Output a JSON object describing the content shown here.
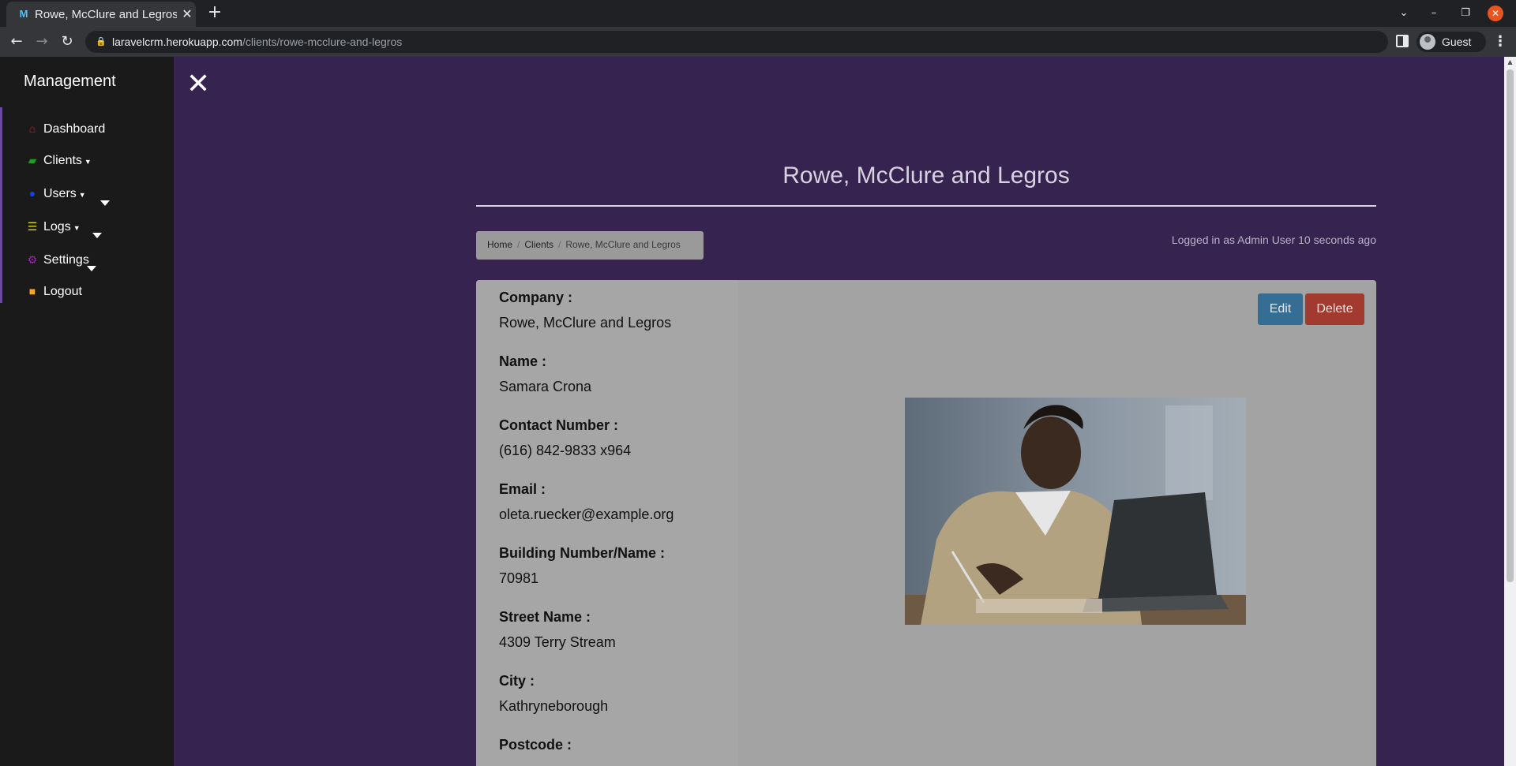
{
  "browser": {
    "tab_title": "Rowe, McClure and Legros",
    "tab_favicon": "M",
    "url_host": "laravelcrm.herokuapp.com",
    "url_path": "/clients/rowe-mcclure-and-legros",
    "profile_label": "Guest"
  },
  "sidebar": {
    "brand": "Management",
    "items": [
      {
        "label": "Dashboard",
        "icon": "home-icon",
        "color": "#d11a1a"
      },
      {
        "label": "Clients",
        "icon": "briefcase-icon",
        "color": "#1e9a1e"
      },
      {
        "label": "Users",
        "icon": "users-icon",
        "color": "#1a3fe0"
      },
      {
        "label": "Logs",
        "icon": "tasks-icon",
        "color": "#e0d81a"
      },
      {
        "label": "Settings",
        "icon": "cogs-icon",
        "color": "#9c27b0"
      },
      {
        "label": "Logout",
        "icon": "folder-icon",
        "color": "#f5a623"
      }
    ]
  },
  "page": {
    "title": "Rowe, McClure and Legros",
    "breadcrumb": [
      "Home",
      "Clients",
      "Rowe, McClure and Legros"
    ],
    "logged_in": "Logged in as Admin User 10 seconds ago"
  },
  "actions": {
    "edit": "Edit",
    "delete": "Delete"
  },
  "client": {
    "fields": [
      {
        "label": "Company :",
        "value": "Rowe, McClure and Legros"
      },
      {
        "label": "Name :",
        "value": "Samara Crona"
      },
      {
        "label": "Contact Number :",
        "value": "(616) 842-9833 x964"
      },
      {
        "label": "Email :",
        "value": "oleta.ruecker@example.org"
      },
      {
        "label": "Building Number/Name :",
        "value": "70981"
      },
      {
        "label": "Street Name :",
        "value": "4309 Terry Stream"
      },
      {
        "label": "City :",
        "value": "Kathryneborough"
      },
      {
        "label": "Postcode :",
        "value": ""
      }
    ]
  }
}
